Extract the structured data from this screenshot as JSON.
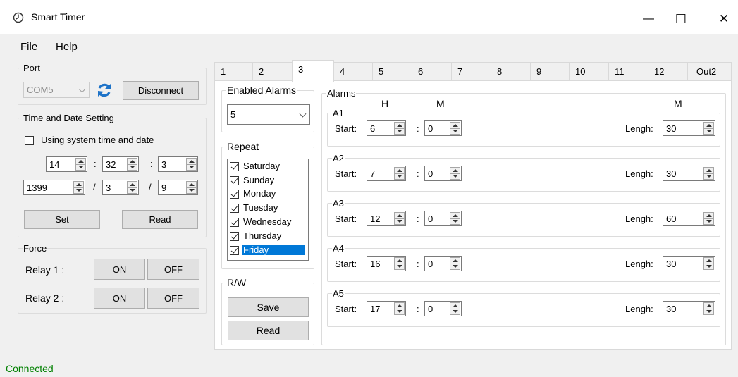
{
  "window": {
    "title": "Smart Timer",
    "minimize": "—",
    "maximize": "☐",
    "close": "✕"
  },
  "menu": [
    "File",
    "Help"
  ],
  "port": {
    "legend": "Port",
    "combo_value": "COM5",
    "disconnect": "Disconnect"
  },
  "time_date": {
    "legend": "Time and Date Setting",
    "use_system_label": "Using system time and date",
    "hour": "14",
    "minute": "32",
    "second": "3",
    "year": "1399",
    "month": "3",
    "day": "9",
    "colon": ":",
    "slash": "/",
    "set": "Set",
    "read": "Read"
  },
  "force": {
    "legend": "Force",
    "relay1_label": "Relay 1 :",
    "relay2_label": "Relay 2 :",
    "on": "ON",
    "off": "OFF"
  },
  "tabs": [
    "1",
    "2",
    "3",
    "4",
    "5",
    "6",
    "7",
    "8",
    "9",
    "10",
    "11",
    "12",
    "Out2"
  ],
  "enabled_alarms": {
    "legend": "Enabled Alarms",
    "value": "5"
  },
  "repeat": {
    "legend": "Repeat",
    "days": [
      "Saturday",
      "Sunday",
      "Monday",
      "Tuesday",
      "Wednesday",
      "Thursday",
      "Friday"
    ]
  },
  "rw": {
    "legend": "R/W",
    "save": "Save",
    "read": "Read"
  },
  "alarms": {
    "legend": "Alarms",
    "h_header": "H",
    "m_header": "M",
    "m_header2": "M",
    "start_label": "Start:",
    "length_label": "Lengh:",
    "colon": ":",
    "items": [
      {
        "name": "A1",
        "h": "6",
        "m": "0",
        "len": "30"
      },
      {
        "name": "A2",
        "h": "7",
        "m": "0",
        "len": "30"
      },
      {
        "name": "A3",
        "h": "12",
        "m": "0",
        "len": "60"
      },
      {
        "name": "A4",
        "h": "16",
        "m": "0",
        "len": "30"
      },
      {
        "name": "A5",
        "h": "17",
        "m": "0",
        "len": "30"
      }
    ]
  },
  "status": "Connected",
  "colors": {
    "accent": "#0078d7",
    "status_ok": "#008000",
    "refresh": "#1e73c8"
  }
}
